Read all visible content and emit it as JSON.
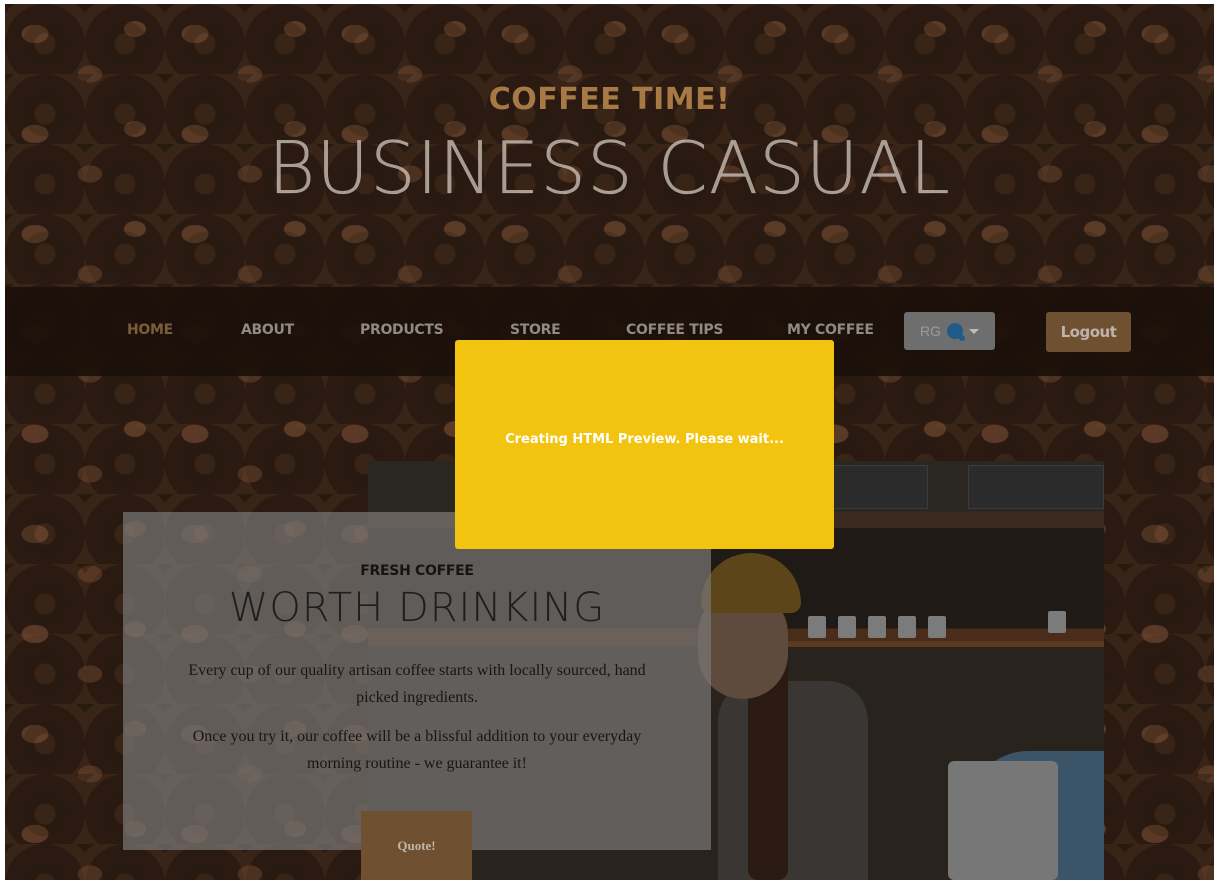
{
  "header": {
    "subtitle": "COFFEE TIME!",
    "title": "BUSINESS CASUAL"
  },
  "nav": {
    "items": [
      {
        "label": "HOME",
        "active": true
      },
      {
        "label": "ABOUT",
        "active": false
      },
      {
        "label": "PRODUCTS",
        "active": false
      },
      {
        "label": "STORE",
        "active": false
      },
      {
        "label": "COFFEE TIPS",
        "active": false
      },
      {
        "label": "MY COFFEE",
        "active": false
      }
    ],
    "profile": {
      "initials": "RG",
      "avatar_icon": "user-avatar-icon",
      "caret_icon": "caret-down-icon"
    },
    "logout_label": "Logout"
  },
  "intro": {
    "upper": "FRESH COFFEE",
    "lower": "WORTH DRINKING",
    "paragraph1": "Every cup of our quality artisan coffee starts with locally sourced, hand picked ingredients.",
    "paragraph2": "Once you try it, our coffee will be a blissful addition to your everyday morning routine - we guarantee it!",
    "button_label": "Quote!"
  },
  "loading": {
    "message": "Creating HTML Preview. Please wait..."
  },
  "colors": {
    "accent": "#a77a45",
    "button": "#6f5131",
    "loading_bg": "#f2c40f"
  }
}
